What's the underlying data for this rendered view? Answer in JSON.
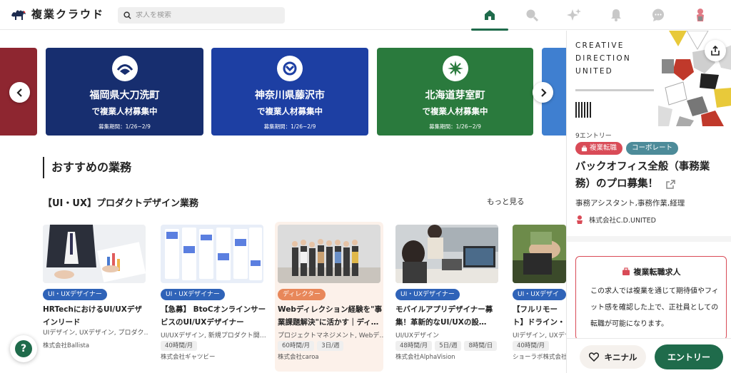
{
  "header": {
    "logo_text": "複業クラウド",
    "search_placeholder": "求人を検索",
    "nav_icons": [
      "home-icon",
      "search-icon",
      "sparkle-icon",
      "bell-icon",
      "chat-icon",
      "avatar"
    ]
  },
  "banners": [
    {
      "line1": "福岡県大刀洗町",
      "line2": "で複業人材募集中",
      "period": "募集期間：1/26~2/9",
      "color": "#172e6f"
    },
    {
      "line1": "神奈川県藤沢市",
      "line2": "で複業人材募集中",
      "period": "募集期間：1/26~2/9",
      "color": "#1d3fa3"
    },
    {
      "line1": "北海道芽室町",
      "line2": "で複業人材募集中",
      "period": "募集期間：1/26~2/9",
      "color": "#2a7a3d"
    }
  ],
  "section_title": "おすすめの業務",
  "category": {
    "title": "【UI・UX】プロダクトデザイン業務",
    "more_label": "もっと見る"
  },
  "cards": [
    {
      "tag": "UI・UXデザイナー",
      "tag_color": "#2f63b8",
      "title": "HRTechにおけるUI/UXデザインリード",
      "skills": "UIデザイン, UXデザイン, プロダク…",
      "chips": [],
      "company": "株式会社Ballista"
    },
    {
      "tag": "UI・UXデザイナー",
      "tag_color": "#2f63b8",
      "title": "【急募】 BtoCオンラインサービスのUI/UXデザイナー",
      "skills": "UI/UXデザイン, 新規プロダクト開…",
      "chips": [
        "40時間/月"
      ],
      "company": "株式会社ギャツビー"
    },
    {
      "tag": "ディレクター",
      "tag_color": "#e8875a",
      "title": "Webディレクション経験を\"事業課題解決\"に活かす｜ディ…",
      "skills": "プロジェクトマネジメント, Webデ…",
      "chips": [
        "60時間/月",
        "3日/週"
      ],
      "company": "株式会社caroa"
    },
    {
      "tag": "UI・UXデザイナー",
      "tag_color": "#2f63b8",
      "title": "モバイルアプリデザイナー募集！革新的なUI/UXの設…",
      "skills": "UI/UXデザイン",
      "chips": [
        "48時間/月",
        "5日/週",
        "8時間/日"
      ],
      "company": "株式会社AlphaVision"
    },
    {
      "tag": "UI・UXデザイナー",
      "tag_color": "#2f63b8",
      "title": "【フルリモート】ドライン・テン",
      "skills": "UIデザイン, UXデザ",
      "chips": [
        "40時間/月"
      ],
      "company": "ショーラボ株式会社"
    }
  ],
  "sidebar": {
    "preview_text": "CREATIVE\nDIRECTION\nUNITED",
    "entry_count": "9エントリー",
    "tag_primary": "複業転職",
    "tag_secondary": "コーポレート",
    "job_title": "バックオフィス全般（事務業務）のプロ募集！",
    "job_subtitle": "事務アシスタント,事務作業,経理",
    "company": "株式会社C.D.UNITED",
    "info_box_title": "複業転職求人",
    "info_box_body": "この求人では複業を通じて期待値やフィット感を確認した上で、正社員としての転職が可能になります。",
    "kininaru_label": "キニナル",
    "entry_label": "エントリー"
  },
  "colors": {
    "brand_green": "#1f6b4b",
    "accent_red": "#d94b57",
    "tag_teal": "#4d8b99"
  }
}
